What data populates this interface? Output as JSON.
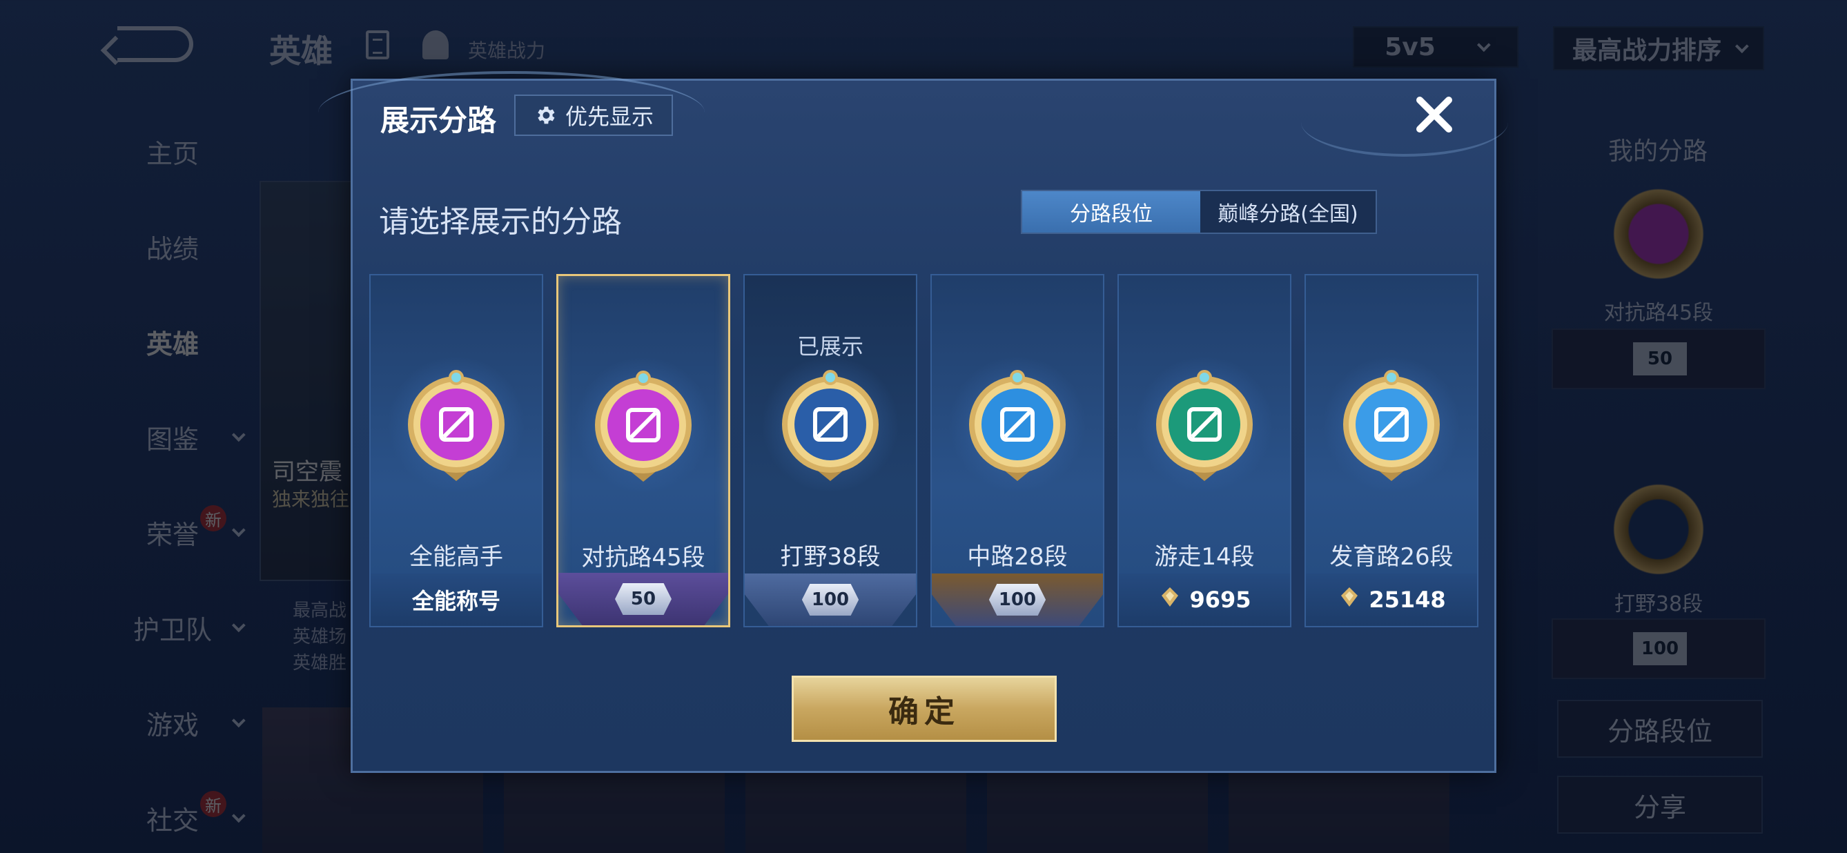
{
  "background": {
    "top_title": "英雄",
    "top_subtitle": "英雄战力",
    "mode_select": "5v5",
    "sort_select": "最高战力排序",
    "sidebar": [
      {
        "label": "主页",
        "has_chevron": false,
        "new": false
      },
      {
        "label": "战绩",
        "has_chevron": false,
        "new": false
      },
      {
        "label": "英雄",
        "has_chevron": false,
        "new": false,
        "active": true
      },
      {
        "label": "图鉴",
        "has_chevron": true,
        "new": false
      },
      {
        "label": "荣誉",
        "has_chevron": true,
        "new": true
      },
      {
        "label": "护卫队",
        "has_chevron": true,
        "new": false
      },
      {
        "label": "游戏",
        "has_chevron": true,
        "new": false
      },
      {
        "label": "社交",
        "has_chevron": true,
        "new": true
      }
    ],
    "new_tag": "新",
    "hero_name": "司空震",
    "hero_tag": "独来独往",
    "hero_stats": [
      "最高战",
      "英雄场",
      "英雄胜"
    ],
    "right_panel": {
      "title": "我的分路",
      "lane1_label": "对抗路45段",
      "lane1_rank": "50",
      "lane2_label": "打野38段",
      "lane2_rank": "100",
      "button1": "分路段位",
      "button2": "分享"
    }
  },
  "modal": {
    "title": "展示分路",
    "priority_button": "优先显示",
    "section_title": "请选择展示的分路",
    "tabs": [
      {
        "label": "分路段位",
        "active": true
      },
      {
        "label": "巅峰分路(全国)",
        "active": false
      }
    ],
    "cards": [
      {
        "name": "全能高手",
        "footer_type": "text",
        "footer": "全能称号",
        "badge_color": "#c43ed4",
        "selected": false,
        "shown": false
      },
      {
        "name": "对抗路45段",
        "footer_type": "rank",
        "footer": "50",
        "ribbon": "purple",
        "badge_color": "#c43ed4",
        "selected": true,
        "shown": false
      },
      {
        "name": "打野38段",
        "footer_type": "rank",
        "footer": "100",
        "ribbon": "blue",
        "badge_color": "#2a5ea8",
        "selected": false,
        "shown": true,
        "shown_label": "已展示"
      },
      {
        "name": "中路28段",
        "footer_type": "rank",
        "footer": "100",
        "ribbon": "gold",
        "badge_color": "#2d8fe0",
        "selected": false,
        "shown": false
      },
      {
        "name": "游走14段",
        "footer_type": "points",
        "footer": "9695",
        "badge_color": "#1c9a7a",
        "selected": false,
        "shown": false
      },
      {
        "name": "发育路26段",
        "footer_type": "points",
        "footer": "25148",
        "badge_color": "#3b9ce8",
        "selected": false,
        "shown": false
      }
    ],
    "confirm_button": "确定"
  },
  "colors": {
    "gold": "#e9c77a",
    "modal_bg": "#1f3a64",
    "accent_blue": "#4d87c9"
  }
}
